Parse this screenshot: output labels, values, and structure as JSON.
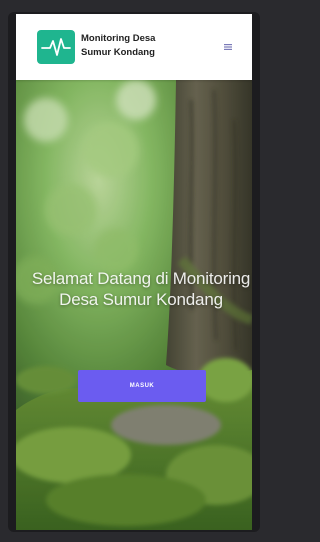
{
  "navbar": {
    "brand_line1": "Monitoring Desa",
    "brand_line2": "Sumur Kondang",
    "logo_icon": "heartbeat-icon",
    "menu_icon": "menu-toggle-icon"
  },
  "hero": {
    "title": "Selamat Datang di Monitoring Desa Sumur Kondang",
    "button_label": "MASUK",
    "background": "forest-tree-moss-photo"
  },
  "colors": {
    "logo_bg": "#1fb58f",
    "button_bg": "#6b5cf0",
    "navbar_bg": "#ffffff"
  }
}
